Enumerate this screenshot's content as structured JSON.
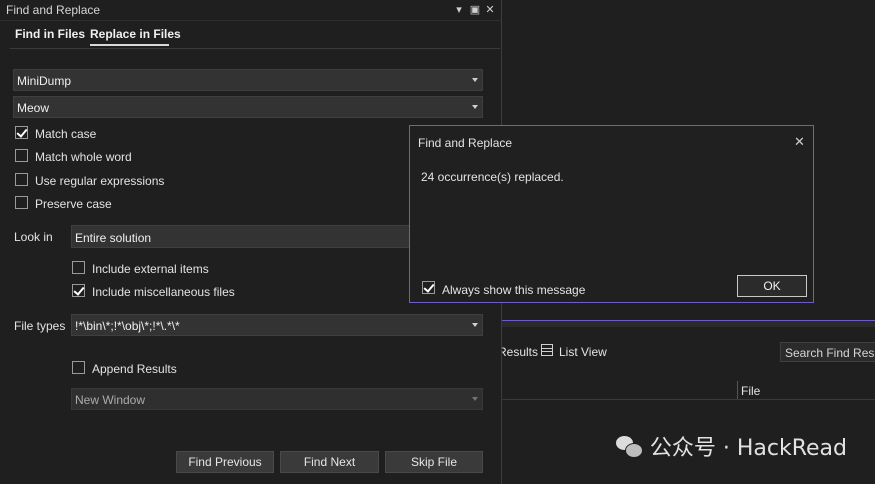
{
  "window": {
    "title": "Find and Replace",
    "icons": [
      "dropdown-arrow-icon",
      "maximize-icon",
      "close-icon"
    ]
  },
  "tabs": [
    {
      "label": "Find in Files"
    },
    {
      "label": "Replace in Files"
    }
  ],
  "find": {
    "value": "MiniDump"
  },
  "replace": {
    "value": "Meow"
  },
  "options": [
    {
      "label": "Match case",
      "checked": true
    },
    {
      "label": "Match whole word",
      "checked": false
    },
    {
      "label": "Use regular expressions",
      "checked": false
    },
    {
      "label": "Preserve case",
      "checked": false
    }
  ],
  "lookin": {
    "label": "Look in",
    "value": "Entire solution"
  },
  "include": [
    {
      "label": "Include external items",
      "checked": false
    },
    {
      "label": "Include miscellaneous files",
      "checked": true
    }
  ],
  "filetypes": {
    "label": "File types",
    "value": "!*\\bin\\*;!*\\obj\\*;!*\\.*\\*"
  },
  "append": {
    "label": "Append Results",
    "checked": false
  },
  "output": {
    "value": "New Window"
  },
  "buttons": {
    "find_previous": "Find Previous",
    "find_next": "Find Next",
    "skip_file": "Skip File"
  },
  "dialog": {
    "title": "Find and Replace",
    "message": "24 occurrence(s) replaced.",
    "checkbox_label": "Always show this message",
    "checkbox_checked": true,
    "ok_label": "OK"
  },
  "results": {
    "tab_partial": "Results",
    "list_view": "List View",
    "search_placeholder": "Search Find Results",
    "column_file": "File"
  },
  "watermark": {
    "text": "公众号 · HackRead"
  },
  "colors": {
    "accent": "#6b5ec9",
    "background": "#1f1f1f"
  }
}
